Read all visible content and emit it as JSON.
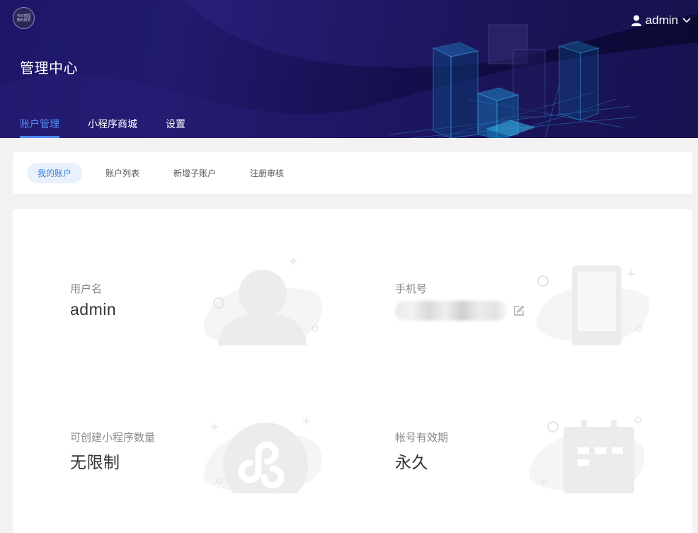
{
  "header": {
    "logo_line1": "今日花园",
    "logo_line2": "明日风华",
    "user_name": "admin",
    "page_title": "管理中心",
    "tabs": [
      {
        "label": "账户管理",
        "active": true
      },
      {
        "label": "小程序商城",
        "active": false
      },
      {
        "label": "设置",
        "active": false
      }
    ]
  },
  "subnav": {
    "tabs": [
      {
        "label": "我的账户",
        "active": true
      },
      {
        "label": "账户列表",
        "active": false
      },
      {
        "label": "新增子账户",
        "active": false
      },
      {
        "label": "注册审核",
        "active": false
      }
    ]
  },
  "account": {
    "username_label": "用户名",
    "username_value": "admin",
    "phone_label": "手机号",
    "phone_value": "",
    "app_quota_label": "可创建小程序数量",
    "app_quota_value": "无限制",
    "validity_label": "帐号有效期",
    "validity_value": "永久"
  },
  "icons": {
    "user": "user-icon",
    "dropdown": "chevron-down-icon",
    "edit": "edit-icon"
  },
  "colors": {
    "accent": "#4d8cf5",
    "header_bg": "#1d1668",
    "subtab_active_bg": "#e9f1fc"
  }
}
